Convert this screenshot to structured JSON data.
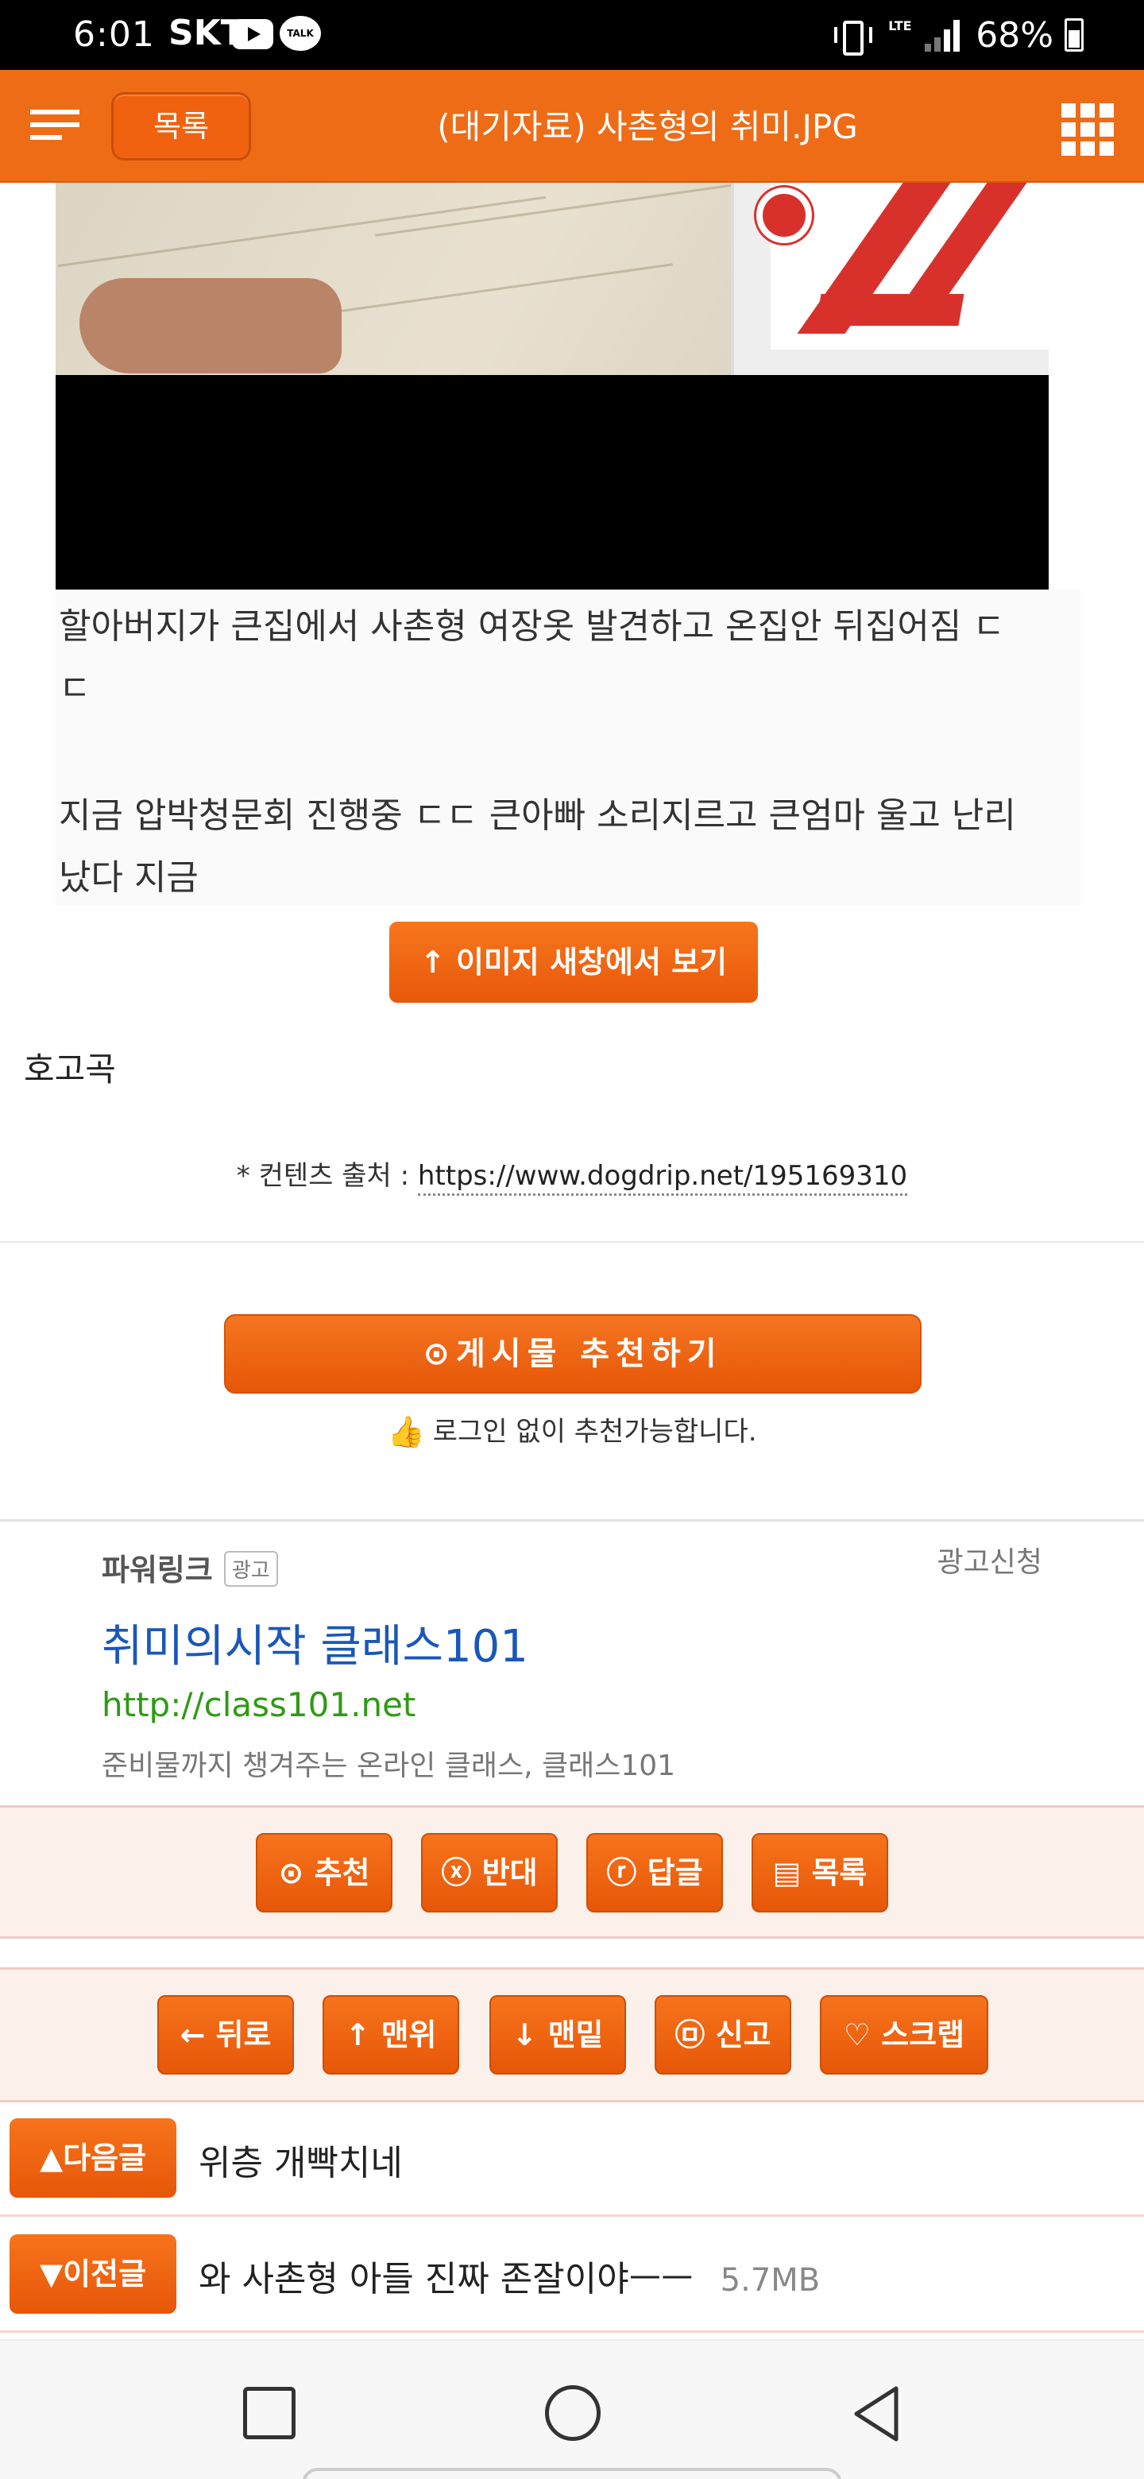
{
  "status_bar": {
    "time": "6:01",
    "carrier": "SKT",
    "talk_label": "TALK",
    "network_label": "LTE",
    "battery": "68%"
  },
  "header": {
    "list_button": "목록",
    "title": "(대기자료) 사촌형의 취미.JPG",
    "brand_color": "#ef6c16"
  },
  "post": {
    "text_line_1": "할아버지가 큰집에서 사촌형 여장옷 발견하고 온집안 뒤집어짐 ㄷ",
    "text_line_2": "ㄷ",
    "text_line_3": "지금 압박청문회 진행중 ㄷㄷ 큰아빠 소리지르고 큰엄마 울고 난리",
    "text_line_4": "났다 지금",
    "view_image_button": "↑ 이미지 새창에서 보기",
    "caption": "호고곡",
    "source_prefix": "* 컨텐츠 출처 : ",
    "source_url": "https://www.dogdrip.net/195169310"
  },
  "recommend": {
    "button": "⊙게시물  추천하기",
    "note": "로그인 없이 추천가능합니다."
  },
  "ad": {
    "label": "파워링크",
    "badge": "광고",
    "request": "광고신청",
    "title": "취미의시작 클래스101",
    "url": "http://class101.net",
    "description": "준비물까지 챙겨주는 온라인 클래스, 클래스101"
  },
  "actions_row_1": [
    "⊙ 추천",
    "ⓧ 반대",
    "ⓡ 답글",
    "▤ 목록"
  ],
  "actions_row_2": [
    "← 뒤로",
    "↑ 맨위",
    "↓ 맨밑",
    "㉤ 신고",
    "♡ 스크랩"
  ],
  "next_post": {
    "button": "▲다음글",
    "title": "위층 개빡치네"
  },
  "prev_post": {
    "button": "▼이전글",
    "title": "와 사촌형 아들 진짜 존잘이야ㅡㅡ",
    "size": "5.7MB"
  }
}
